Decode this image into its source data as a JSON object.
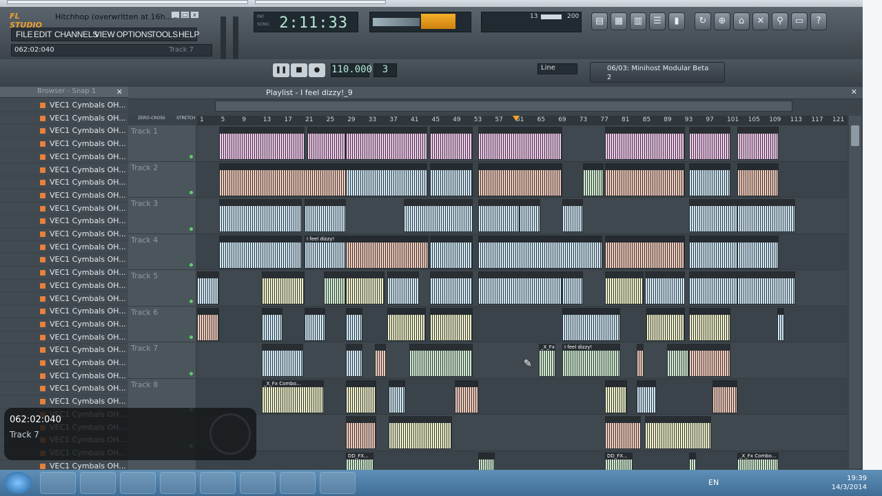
{
  "app": {
    "logo": "FL STUDIO",
    "project_title": "Hitchhop (overwritten at 16h...",
    "win_min": "_",
    "win_max": "□",
    "win_close": "x"
  },
  "menu": [
    "FILE",
    "EDIT",
    "CHANNELS",
    "VIEW",
    "OPTIONS",
    "TOOLS",
    "HELP"
  ],
  "hint": {
    "time": "062:02:040",
    "track": "Track 7"
  },
  "clock": {
    "time": "2:11:33",
    "pat_label": "PAT",
    "song_label": "SONG"
  },
  "cpu": {
    "value1": "13",
    "value2": "200"
  },
  "transport": {
    "tempo": "110.000",
    "pattern": "3",
    "snap": "Line"
  },
  "plugin": {
    "name": "06/03: Minihost Modular Beta",
    "num": "2"
  },
  "browser": {
    "title": "Browser - Snap 1",
    "item_label": "VEC1 Cymbals  OH...",
    "items_count": 29
  },
  "playlist": {
    "title": "Playlist - I feel dizzy!_9",
    "zero_cross": "ZERO-CROSS",
    "stretch": "STRETCH"
  },
  "ruler": [
    "1",
    "5",
    "9",
    "13",
    "17",
    "21",
    "25",
    "29",
    "33",
    "37",
    "41",
    "45",
    "49",
    "53",
    "57",
    "61",
    "65",
    "69",
    "73",
    "77",
    "81",
    "85",
    "89",
    "93",
    "97",
    "101",
    "105",
    "109",
    "113",
    "117",
    "121"
  ],
  "tracks": [
    "Track 1",
    "Track 2",
    "Track 3",
    "Track 4",
    "Track 5",
    "Track 6",
    "Track 7",
    "Track 8",
    "",
    ""
  ],
  "clip_labels": {
    "dizzy": "I feel dizzy!",
    "fx_combo": "_X_Fx Combo...",
    "dd_fx": "DD_FX...",
    "fx_short": "_X_Fx..."
  },
  "overlay": {
    "time": "062:02:040",
    "track": "Track 7"
  },
  "taskbar": {
    "lang": "EN",
    "time": "19:39",
    "date": "14/3/2014"
  },
  "colors": {
    "pink": "#f4c6ea",
    "blue": "#cfe6f4",
    "cream": "#f0efc4",
    "green": "#cfeacc",
    "salmon": "#f4c9b6"
  }
}
